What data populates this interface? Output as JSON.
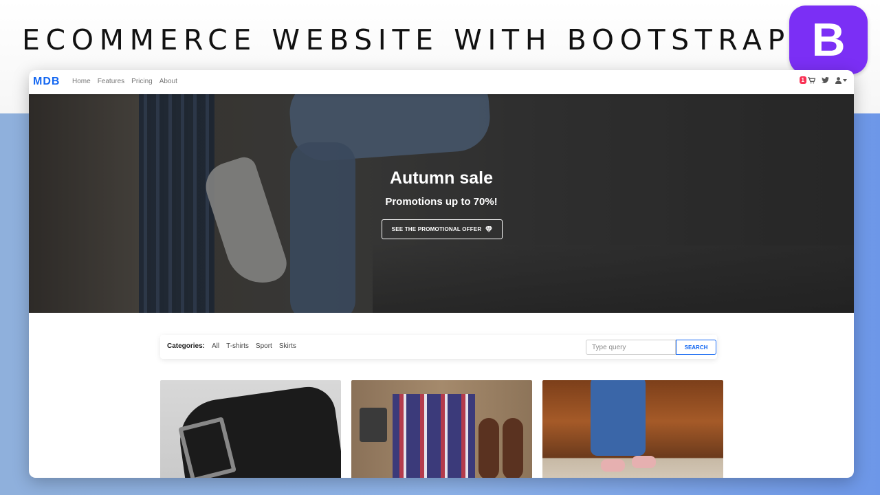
{
  "banner": {
    "title": "ECOMMERCE WEBSITE WITH BOOTSTRAP 5",
    "logo_letter": "B",
    "logo_color": "#7b2ff5"
  },
  "navbar": {
    "brand": "MDB",
    "links": [
      "Home",
      "Features",
      "Pricing",
      "About"
    ],
    "cart_count": "1",
    "icons": [
      "cart-icon",
      "twitter-icon",
      "user-icon",
      "caret-down-icon"
    ]
  },
  "hero": {
    "title": "Autumn sale",
    "subtitle": "Promotions up to 70%!",
    "button_label": "SEE THE PROMOTIONAL OFFER",
    "button_icon": "gem-icon"
  },
  "filters": {
    "label": "Categories:",
    "items": [
      "All",
      "T-shirts",
      "Sport",
      "Skirts"
    ],
    "search_placeholder": "Type query",
    "search_button": "SEARCH"
  },
  "products": [
    {
      "image": "belt"
    },
    {
      "image": "shirt-flatlay"
    },
    {
      "image": "jeans-sneakers"
    }
  ],
  "colors": {
    "primary": "#1266f1",
    "badge": "#f93154"
  }
}
